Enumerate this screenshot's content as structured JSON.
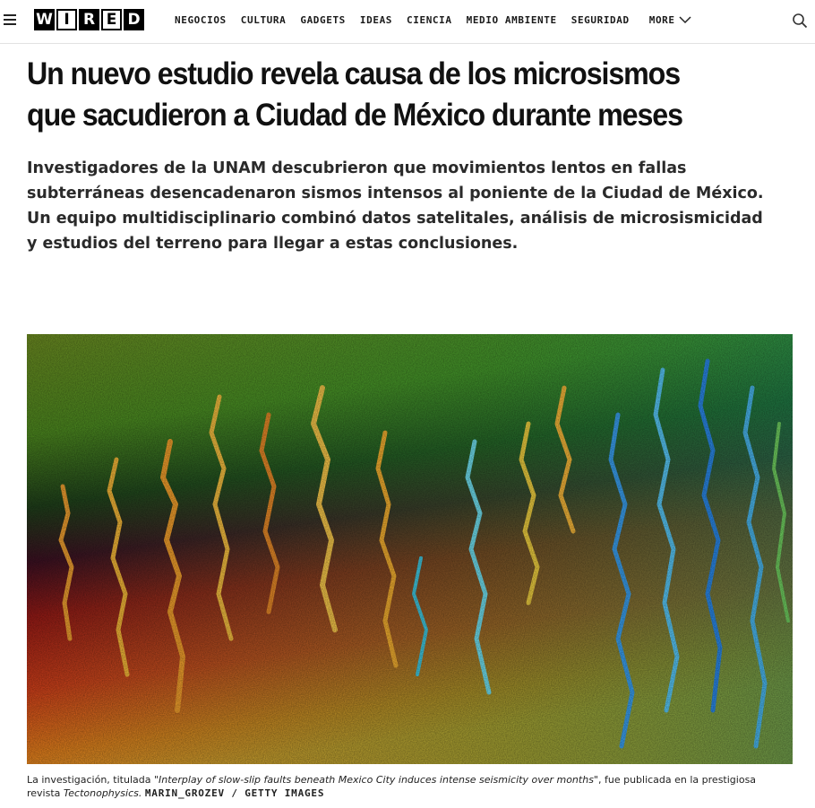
{
  "header": {
    "logo_letters": [
      "W",
      "I",
      "R",
      "E",
      "D"
    ],
    "nav": [
      "NEGOCIOS",
      "CULTURA",
      "GADGETS",
      "IDEAS",
      "CIENCIA",
      "MEDIO AMBIENTE",
      "SEGURIDAD"
    ],
    "more_label": "MORE"
  },
  "article": {
    "title": "Un nuevo estudio revela causa de los microsismos que sacudieron a Ciudad de México durante meses",
    "dek": "Investigadores de la UNAM descubrieron que movimientos lentos en fallas subterráneas desencadenaron sismos intensos al poniente de la Ciudad de México. Un equipo multidisciplinario combinó datos satelitales, análisis de microsismicidad y estudios del terreno para llegar a estas conclusiones.",
    "caption": {
      "prefix": "La investigación, titulada ",
      "study_title": "\"Interplay of slow-slip faults beneath Mexico City induces intense seismicity over months\"",
      "middle": ", fue publicada en la prestigiosa revista ",
      "journal": "Tectonophysics.",
      "credit": "MARIN_GROZEV / GETTY IMAGES"
    }
  },
  "colors": {
    "image_green": "#4f8a1c",
    "image_red": "#b81f17",
    "image_orange": "#e8781a",
    "image_blue": "#1e6fe0"
  }
}
